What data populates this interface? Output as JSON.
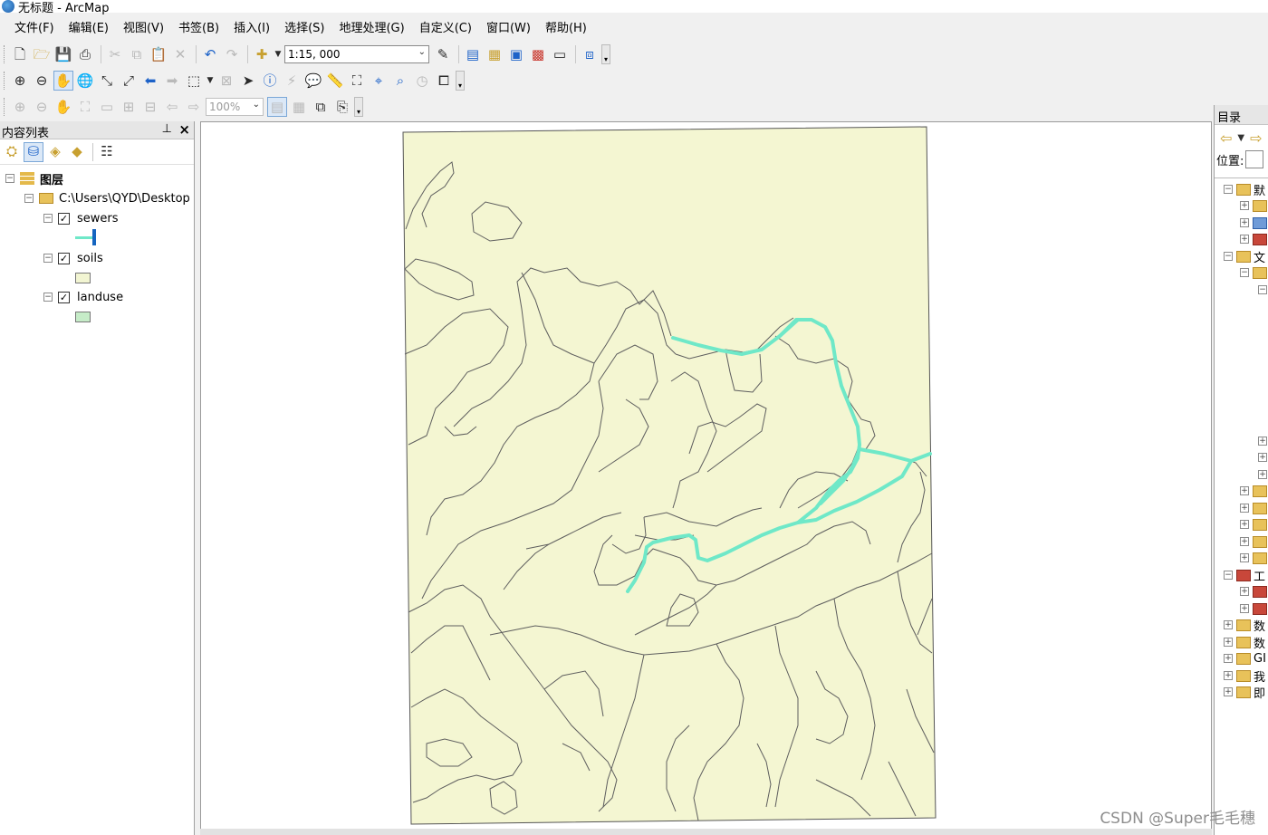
{
  "window": {
    "title": "无标题 - ArcMap"
  },
  "menu": [
    "文件(F)",
    "编辑(E)",
    "视图(V)",
    "书签(B)",
    "插入(I)",
    "选择(S)",
    "地理处理(G)",
    "自定义(C)",
    "窗口(W)",
    "帮助(H)"
  ],
  "toolbar": {
    "scale_value": "1:15, 000",
    "layout_zoom": "100%"
  },
  "icons": {
    "new": "new-document-icon",
    "open": "open-folder-icon",
    "save": "save-icon",
    "print": "print-icon",
    "cut": "cut-icon",
    "copy": "copy-icon",
    "paste": "paste-icon",
    "delete": "delete-icon",
    "undo": "undo-icon",
    "redo": "redo-icon",
    "add_data": "add-data-icon",
    "zoom_in": "zoom-in-icon",
    "zoom_out": "zoom-out-icon",
    "pan": "pan-hand-icon",
    "full_extent": "globe-icon",
    "identify": "identify-icon",
    "find": "binoculars-icon",
    "select": "select-arrow-icon"
  },
  "toc": {
    "title": "内容列表",
    "layers_group": "图层",
    "data_path": "C:\\Users\\QYD\\Desktop",
    "layers": [
      {
        "name": "sewers",
        "checked": true,
        "symbol_type": "line",
        "color": "#6fe8c8",
        "accent": "#1565c0"
      },
      {
        "name": "soils",
        "checked": true,
        "symbol_type": "fill",
        "color": "#f2f5d2"
      },
      {
        "name": "landuse",
        "checked": true,
        "symbol_type": "fill",
        "color": "#c6ecc8"
      }
    ]
  },
  "map": {
    "fill_color": "#f4f6d2",
    "line_color": "#5e5e5e",
    "sewer_color": "#6fe8c8"
  },
  "catalog": {
    "title": "目录",
    "location_label": "位置:",
    "items": [
      "默",
      "文",
      "工",
      "数",
      "数",
      "GI",
      "我",
      "即"
    ]
  },
  "watermark": "CSDN @Super毛毛穗"
}
